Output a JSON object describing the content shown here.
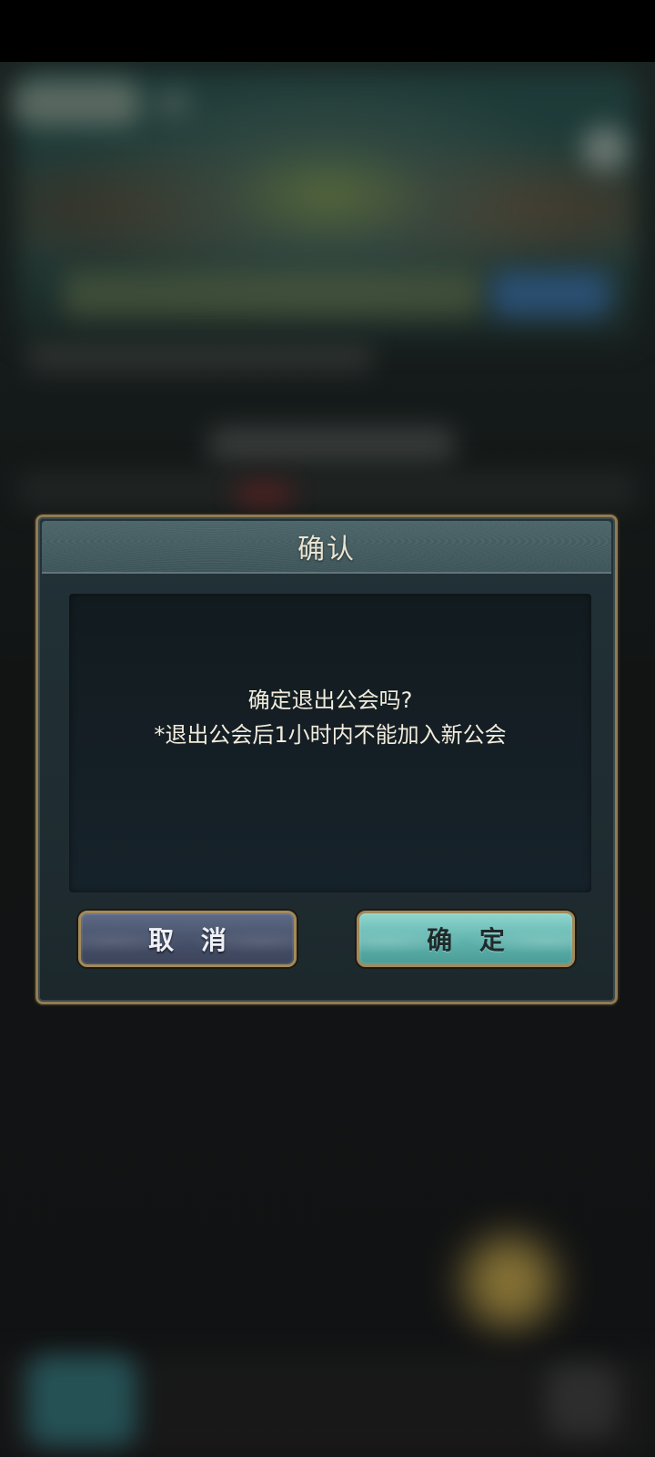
{
  "dialog": {
    "title": "确认",
    "message_line1": "确定退出公会吗?",
    "message_line2": "*退出公会后1小时内不能加入新公会",
    "cancel_label": "取 消",
    "confirm_label": "确 定"
  },
  "colors": {
    "frame_gold": "#8f7c55",
    "cancel_button": "#465069",
    "confirm_button": "#5fb3ad",
    "text_light": "#f1ecdc"
  }
}
